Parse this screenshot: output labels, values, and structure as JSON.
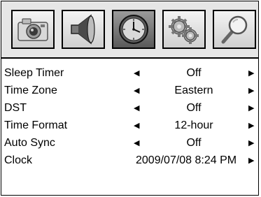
{
  "tabs": [
    {
      "icon": "camera-icon",
      "active": false
    },
    {
      "icon": "speaker-icon",
      "active": false
    },
    {
      "icon": "clock-icon",
      "active": true
    },
    {
      "icon": "gears-icon",
      "active": false
    },
    {
      "icon": "magnifier-icon",
      "active": false
    }
  ],
  "menu": {
    "left_arrow": "◀",
    "right_arrow": "▶",
    "items": [
      {
        "label": "Sleep Timer",
        "value": "Off"
      },
      {
        "label": "Time Zone",
        "value": "Eastern"
      },
      {
        "label": "DST",
        "value": "Off"
      },
      {
        "label": "Time Format",
        "value": "12-hour"
      },
      {
        "label": "Auto Sync",
        "value": "Off"
      },
      {
        "label": "Clock",
        "value": "2009/07/08 8:24 PM"
      }
    ]
  }
}
